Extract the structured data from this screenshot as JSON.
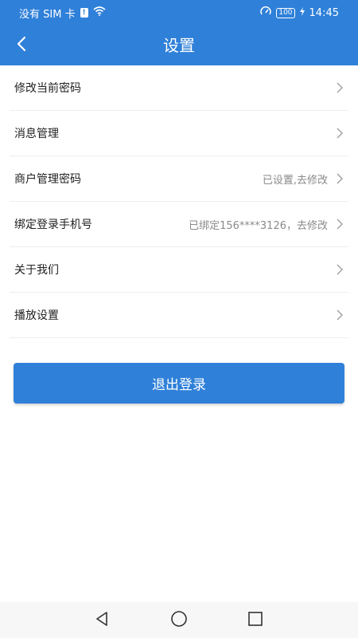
{
  "status_bar": {
    "carrier": "没有 SIM 卡",
    "sim_alert": "!",
    "battery": "100",
    "time": "14:45"
  },
  "header": {
    "title": "设置",
    "back_icon": "chevron-left-icon"
  },
  "settings": {
    "items": [
      {
        "label": "修改当前密码",
        "value": ""
      },
      {
        "label": "消息管理",
        "value": ""
      },
      {
        "label": "商户管理密码",
        "value": "已设置,去修改"
      },
      {
        "label": "绑定登录手机号",
        "value": "已绑定156****3126，去修改"
      },
      {
        "label": "关于我们",
        "value": ""
      },
      {
        "label": "播放设置",
        "value": ""
      }
    ]
  },
  "logout": {
    "label": "退出登录"
  },
  "colors": {
    "brand": "#2f80d9",
    "text": "#222222",
    "secondary_text": "#8a8a8a"
  }
}
